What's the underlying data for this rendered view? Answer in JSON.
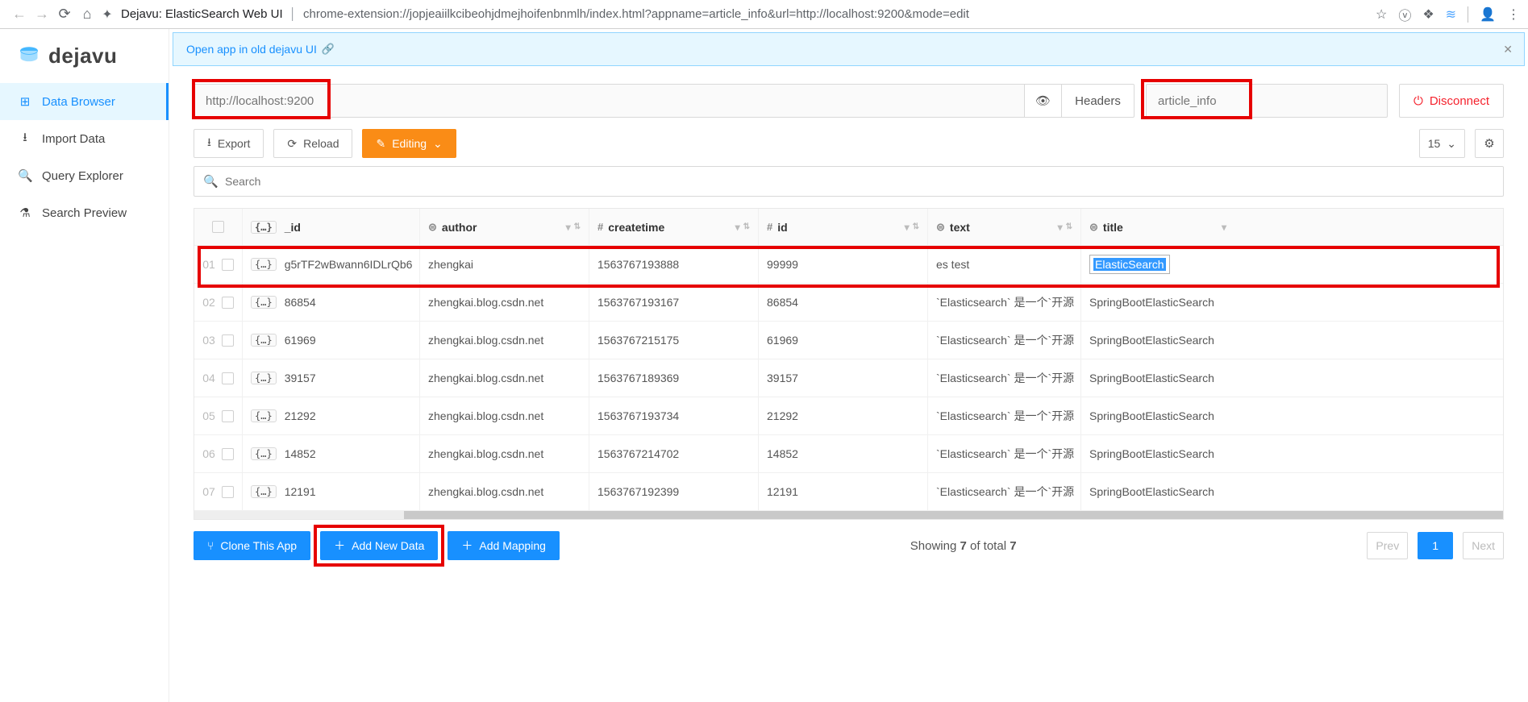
{
  "chrome": {
    "title": "Dejavu: ElasticSearch Web UI",
    "url": "chrome-extension://jopjeaiilkcibeohjdmejhoifenbnmlh/index.html?appname=article_info&url=http://localhost:9200&mode=edit"
  },
  "logo_text": "dejavu",
  "sidebar": {
    "items": [
      {
        "icon": "⊞",
        "label": "Data Browser",
        "active": true
      },
      {
        "icon": "⭳",
        "label": "Import Data",
        "active": false
      },
      {
        "icon": "🔍",
        "label": "Query Explorer",
        "active": false
      },
      {
        "icon": "⚗",
        "label": "Search Preview",
        "active": false
      }
    ]
  },
  "banner": {
    "text": "Open app in old dejavu UI"
  },
  "connection": {
    "url_placeholder": "http://localhost:9200",
    "headers_label": "Headers",
    "appname_placeholder": "article_info",
    "disconnect_label": "Disconnect"
  },
  "toolbar": {
    "export_label": "Export",
    "reload_label": "Reload",
    "editing_label": "Editing",
    "page_size": "15"
  },
  "search": {
    "placeholder": "Search"
  },
  "table": {
    "columns": {
      "id": "_id",
      "author": "author",
      "createtime": "createtime",
      "iid": "id",
      "text": "text",
      "title": "title"
    },
    "rows": [
      {
        "n": "01",
        "_id": "g5rTF2wBwann6IDLrQb6",
        "author": "zhengkai",
        "createtime": "1563767193888",
        "iid": "99999",
        "text": "es test",
        "title": "ElasticSearch",
        "editing": true
      },
      {
        "n": "02",
        "_id": "86854",
        "author": "zhengkai.blog.csdn.net",
        "createtime": "1563767193167",
        "iid": "86854",
        "text": "`Elasticsearch` 是一个`开源",
        "title": "SpringBootElasticSearch"
      },
      {
        "n": "03",
        "_id": "61969",
        "author": "zhengkai.blog.csdn.net",
        "createtime": "1563767215175",
        "iid": "61969",
        "text": "`Elasticsearch` 是一个`开源",
        "title": "SpringBootElasticSearch"
      },
      {
        "n": "04",
        "_id": "39157",
        "author": "zhengkai.blog.csdn.net",
        "createtime": "1563767189369",
        "iid": "39157",
        "text": "`Elasticsearch` 是一个`开源",
        "title": "SpringBootElasticSearch"
      },
      {
        "n": "05",
        "_id": "21292",
        "author": "zhengkai.blog.csdn.net",
        "createtime": "1563767193734",
        "iid": "21292",
        "text": "`Elasticsearch` 是一个`开源",
        "title": "SpringBootElasticSearch"
      },
      {
        "n": "06",
        "_id": "14852",
        "author": "zhengkai.blog.csdn.net",
        "createtime": "1563767214702",
        "iid": "14852",
        "text": "`Elasticsearch` 是一个`开源",
        "title": "SpringBootElasticSearch"
      },
      {
        "n": "07",
        "_id": "12191",
        "author": "zhengkai.blog.csdn.net",
        "createtime": "1563767192399",
        "iid": "12191",
        "text": "`Elasticsearch` 是一个`开源",
        "title": "SpringBootElasticSearch"
      }
    ]
  },
  "footer": {
    "clone_label": "Clone This App",
    "add_data_label": "Add New Data",
    "add_mapping_label": "Add Mapping",
    "showing_prefix": "Showing ",
    "count": "7",
    "of_total": " of total ",
    "total": "7",
    "prev": "Prev",
    "page": "1",
    "next": "Next"
  }
}
